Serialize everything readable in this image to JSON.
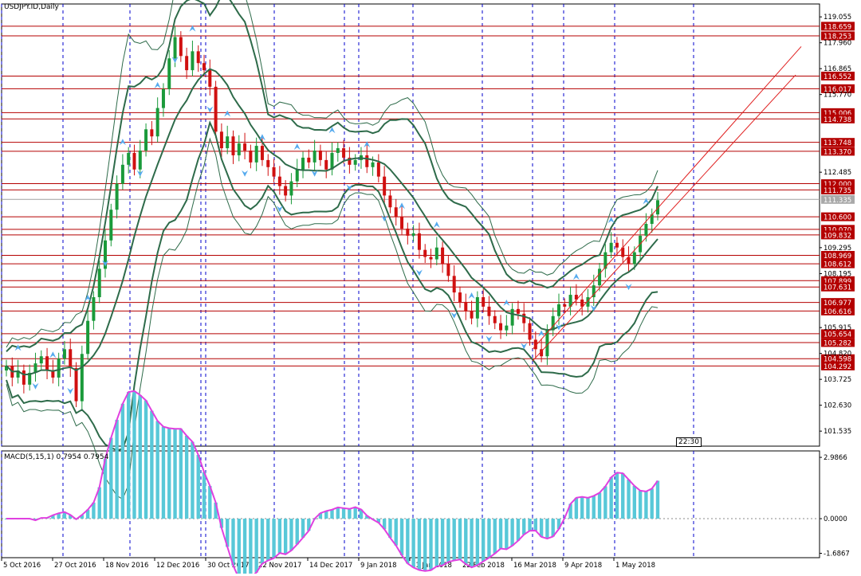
{
  "chart_title": "USDJPY.ID,Daily",
  "server_time": "22:30",
  "price_axis_ticks": [
    "119.055",
    "117.960",
    "116.865",
    "115.770",
    "112.485",
    "109.295",
    "108.195",
    "105.915",
    "104.820",
    "103.725",
    "102.630",
    "101.535"
  ],
  "horizontal_levels": [
    {
      "label": "118.659",
      "value": 118.659
    },
    {
      "label": "118.253",
      "value": 118.253
    },
    {
      "label": "116.552",
      "value": 116.552
    },
    {
      "label": "116.017",
      "value": 116.017
    },
    {
      "label": "115.006",
      "value": 115.006
    },
    {
      "label": "114.738",
      "value": 114.738
    },
    {
      "label": "113.748",
      "value": 113.748
    },
    {
      "label": "113.370",
      "value": 113.37
    },
    {
      "label": "112.000",
      "value": 112.0
    },
    {
      "label": "111.735",
      "value": 111.735
    },
    {
      "label": "110.600",
      "value": 110.6
    },
    {
      "label": "110.070",
      "value": 110.07
    },
    {
      "label": "109.832",
      "value": 109.832
    },
    {
      "label": "108.969",
      "value": 108.969
    },
    {
      "label": "108.612",
      "value": 108.612
    },
    {
      "label": "107.899",
      "value": 107.899
    },
    {
      "label": "107.631",
      "value": 107.631
    },
    {
      "label": "106.977",
      "value": 106.977
    },
    {
      "label": "106.616",
      "value": 106.616
    },
    {
      "label": "105.654",
      "value": 105.654
    },
    {
      "label": "105.282",
      "value": 105.282
    },
    {
      "label": "104.598",
      "value": 104.598
    },
    {
      "label": "104.292",
      "value": 104.292
    }
  ],
  "current_price": {
    "label": "111.335",
    "value": 111.335
  },
  "date_labels": [
    "5 Oct 2016",
    "27 Oct 2016",
    "18 Nov 2016",
    "12 Dec 2016",
    "30 Oct 2017",
    "22 Nov 2017",
    "14 Dec 2017",
    "9 Jan 2018",
    "31 Jan 2018",
    "22 Feb 2018",
    "16 Mar 2018",
    "9 Apr 2018",
    "1 May 2018"
  ],
  "macd": {
    "title": "MACD(5,15,1) 0.7954 0.7954",
    "axis_ticks": [
      {
        "label": "2.9866",
        "value": 2.9866
      },
      {
        "label": "0.0000",
        "value": 0
      },
      {
        "label": "-1.6867",
        "value": -1.6867
      }
    ]
  },
  "colors": {
    "background": "#ffffff",
    "level_line": "#b40000",
    "level_label_bg": "#b40000",
    "current_label_bg": "#a9a9a9",
    "grid_dash": "#0000cc",
    "bands_thick": "#2e6b4a",
    "bands_thin": "#2e6b4a",
    "bull_candle": "#1a9a3a",
    "bear_candle": "#d01010",
    "fractal": "#55aaee",
    "macd_hist": "#58c8d8",
    "macd_signal": "#e040e0",
    "trend_line": "#e02020"
  },
  "chart_data": {
    "type": "candlestick",
    "title": "USDJPY.ID,Daily",
    "ylim": [
      100.9,
      119.6
    ],
    "close": [
      104.3,
      103.8,
      104.1,
      103.5,
      104.0,
      104.4,
      104.7,
      104.1,
      103.8,
      104.6,
      105.0,
      104.2,
      102.8,
      104.8,
      106.2,
      107.2,
      108.4,
      109.6,
      110.9,
      112.0,
      112.8,
      113.3,
      112.6,
      113.4,
      114.3,
      114.0,
      115.2,
      116.0,
      117.3,
      118.2,
      117.4,
      116.8,
      117.6,
      117.1,
      116.8,
      116.1,
      114.2,
      113.5,
      114.0,
      113.2,
      113.7,
      113.4,
      112.9,
      113.6,
      113.0,
      112.7,
      112.3,
      111.9,
      111.5,
      112.1,
      112.6,
      113.1,
      112.9,
      113.4,
      113.0,
      112.6,
      113.3,
      113.5,
      113.1,
      112.8,
      113.0,
      113.2,
      112.7,
      112.9,
      112.3,
      111.5,
      111.0,
      110.6,
      110.1,
      109.8,
      109.9,
      109.2,
      108.9,
      108.8,
      109.3,
      108.6,
      108.1,
      107.4,
      107.0,
      106.6,
      106.3,
      107.2,
      106.8,
      106.4,
      106.1,
      105.8,
      106.0,
      106.7,
      106.5,
      106.1,
      105.4,
      105.0,
      104.7,
      105.8,
      106.4,
      106.9,
      106.8,
      107.3,
      107.1,
      106.8,
      107.2,
      107.7,
      108.4,
      109.1,
      109.5,
      109.3,
      108.9,
      108.6,
      109.1,
      109.8,
      110.3,
      110.7,
      111.3
    ]
  }
}
